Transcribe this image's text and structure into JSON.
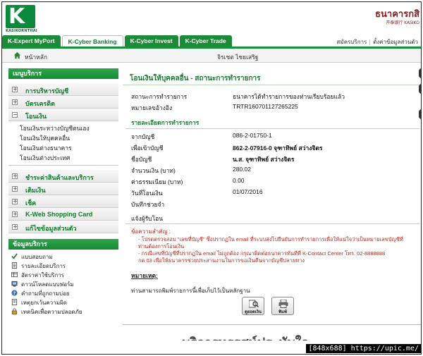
{
  "brand": {
    "logo_letter": "K",
    "logo_text": "KASIKORNTHAI",
    "bank_name": "ธนาคารกสิ",
    "bank_name_en": "开泰银行 KASIKO",
    "brand_color": "#0a8a3a"
  },
  "tabs": [
    {
      "label": "K-Expert MyPort",
      "active": false
    },
    {
      "label": "K-Cyber Banking",
      "active": true
    },
    {
      "label": "K-Cyber Invest",
      "active": false
    },
    {
      "label": "K-Cyber Trade",
      "active": false
    }
  ],
  "top_links": {
    "apply": "สมัครบริการ",
    "settings": "ตั้งค่าข้อมูลส่วนตัว"
  },
  "home": {
    "label": "หน้าหลัก",
    "user_name": "จิรเชต ไชยเสริฐ"
  },
  "sidebar": {
    "menu_title": "เมนูบริการ",
    "items": [
      {
        "label": "การบริหารบัญชี",
        "toggle": "+"
      },
      {
        "label": "บัตรเครดิต",
        "toggle": "+"
      },
      {
        "label": "โอนเงิน",
        "toggle": "−"
      }
    ],
    "transfer_sub": [
      "โอนเงินระหว่างบัญชีตนเอง",
      "โอนเงินให้บุคคลอื่น",
      "โอนเงินต่างธนาคาร",
      "โอนเงินต่างประเทศ"
    ],
    "items2": [
      {
        "label": "ชำระค่าสินค้าและบริการ",
        "toggle": "+"
      },
      {
        "label": "เติมเงิน",
        "toggle": "+"
      },
      {
        "label": "เช็ค",
        "toggle": "+"
      },
      {
        "label": "K-Web Shopping Card",
        "toggle": "+"
      },
      {
        "label": "แก้ไขข้อมูลส่วนตัว",
        "toggle": "+"
      }
    ],
    "services_title": "ข้อมูลบริการ",
    "services": [
      {
        "label": "แบบสอบถาม",
        "icon": "checkmark-icon"
      },
      {
        "label": "รายละเอียดบริการ",
        "icon": "document-icon"
      },
      {
        "label": "อัตราค่าใช้บริการ",
        "icon": "table-icon"
      },
      {
        "label": "ดาวน์โหลดแบบฟอร์ม",
        "icon": "download-icon"
      },
      {
        "label": "คำถามที่ถูกถามบ่อย",
        "icon": "question-icon"
      },
      {
        "label": "เหตุยกเว้นความผิด",
        "icon": "document-icon"
      },
      {
        "label": "เทคนิคเพื่อความปลอดภัย",
        "icon": "lock-icon"
      }
    ]
  },
  "main": {
    "title": "โอนเงินให้บุคคลอื่น - สถานะการทำรายการ",
    "status_label": "สถานะการทำรายการ",
    "status_value": "ธนาคารได้ทำรายการของท่านเรียบร้อยแล้ว",
    "ref_label": "หมายเลขอ้างอิง",
    "ref_value": "TRTR160701127265225",
    "details_title": "รายละเอียดการทำรายการ",
    "rows": [
      {
        "k": "จากบัญชี",
        "v": "086-2-01750-1",
        "bold": false
      },
      {
        "k": "เพื่อเข้าบัญชี",
        "v": "862-2-07916-0 จุฑาทิพย์ สว่างจิตร",
        "bold": true
      },
      {
        "k": "ชื่อบัญชี",
        "v": "น.ส. จุฑาทิพย์ สว่างจิตร",
        "bold": true
      },
      {
        "k": "จำนวนเงิน (บาท)",
        "v": "280.02",
        "bold": false
      },
      {
        "k": "ค่าธรรมเนียม (บาท)",
        "v": "0.00",
        "bold": false
      },
      {
        "k": "วันที่โอนเงิน",
        "v": "01/07/2016",
        "bold": false
      },
      {
        "k": "บันทึกช่วยจำ",
        "v": "",
        "bold": false
      }
    ],
    "notify_label": "แจ้งผู้รับโอน",
    "notice_title": "ข้อความสำคัญ :",
    "notice_lines": [
      "- โปรดตรวจสอบ \"เลขที่บัญชี\" ซึ่งปรากฏใน email ที่ระบบส่งไปยืนยันการทำรายการเพื่อให้แน่ใจว่าเป็นหมายเลขบัญชีที่",
      "ท่านต้องการโอนเงิน",
      "- กรณีเลขที่บัญชีที่ปรากฏใน email ไม่ถูกต้อง กรุณาติดต่อธนาคารทันทีที่ K-Contact Center โทร. 02-8888888",
      "กด 03 เพื่อให้ธนาคารช่วยประสานงานในการขอเงินคืนจากบัญชีปลายทาง"
    ],
    "remark_title": "หมายเหตุ:",
    "remark_text": "ท่านสามารถพิมพ์รายการนี้เพื่อเก็บไว้เป็นหลักฐาน",
    "buttons": {
      "view": "ดูยอดเงิน",
      "print": "พิมพ์"
    },
    "banner": "บริการทรรศน์ประทับใจ"
  },
  "watermark": "[848x688] https://upic.me/"
}
